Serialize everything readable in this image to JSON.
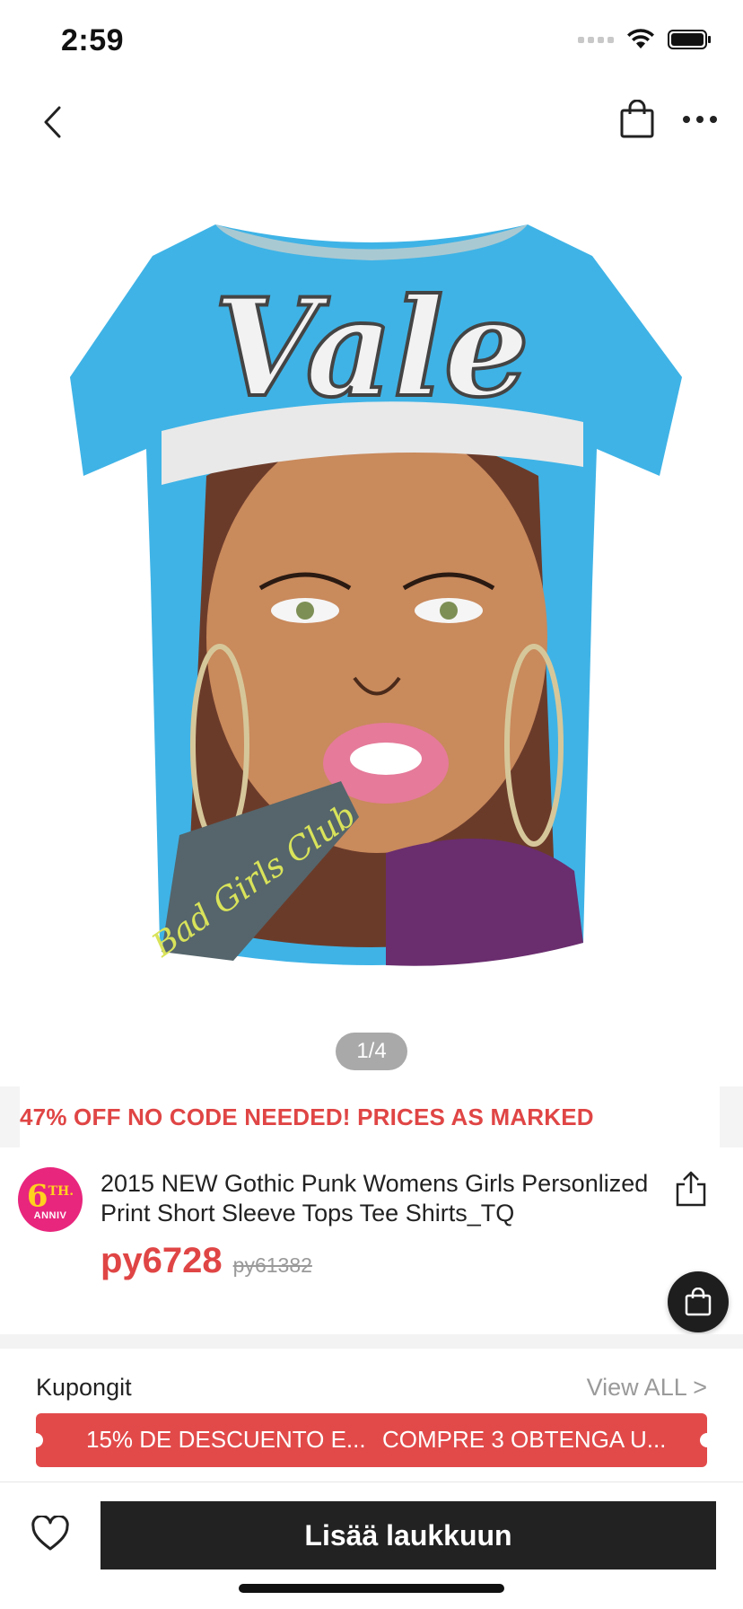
{
  "status_bar": {
    "time": "2:59"
  },
  "nav": {
    "back_icon": "chevron-left-icon",
    "bag_icon": "shopping-bag-icon",
    "more_icon": "more-dots-icon"
  },
  "gallery": {
    "pager": "1/4",
    "shirt_text": "Vale",
    "bottle_text": "Bad Girls Club"
  },
  "promo": {
    "text": "47% OFF NO CODE NEEDED! PRICES AS MARKED"
  },
  "product": {
    "badge_number": "6",
    "badge_suffix": "TH.",
    "badge_label": "ANNIV",
    "title": "2015 NEW Gothic Punk Womens Girls Personlized Print Short Sleeve Tops Tee Shirts_TQ",
    "price": "py6728",
    "original_price": "py61382"
  },
  "coupons": {
    "title": "Kupongit",
    "view_all": "View ALL >",
    "items": [
      "15% DE DESCUENTO E...",
      "COMPRE 3 OBTENGA U..."
    ]
  },
  "bottom_bar": {
    "add_to_bag": "Lisää laukkuun"
  },
  "colors": {
    "accent_red": "#e04545",
    "button_dark": "#222222",
    "badge_pink": "#e8267d",
    "shirt_blue": "#3fb3e6"
  }
}
